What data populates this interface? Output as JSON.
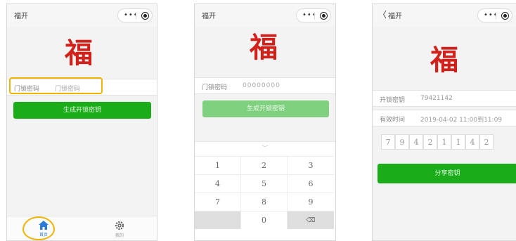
{
  "screen1": {
    "title": "福开",
    "fu": "福",
    "field_label": "门锁密码",
    "field_placeholder": "门锁密码",
    "button": "生成开锁密钥",
    "tabs": [
      {
        "label": "首页",
        "icon": "home-icon",
        "active": true
      },
      {
        "label": "我的",
        "icon": "settings-icon",
        "active": false
      }
    ]
  },
  "screen2": {
    "title": "福开",
    "fu": "福",
    "field_label": "门锁密码",
    "field_value": "00000000",
    "button": "生成开锁密钥",
    "keypad": [
      "1",
      "2",
      "3",
      "4",
      "5",
      "6",
      "7",
      "8",
      "9",
      "",
      "0",
      "⌫"
    ]
  },
  "screen3": {
    "title": "福开",
    "fu": "福",
    "key_label": "开锁密钥",
    "key_value": "79421142",
    "time_label": "有效时间",
    "time_value": "2019-04-02 11:00到11:09",
    "digits": [
      "7",
      "9",
      "4",
      "2",
      "1",
      "1",
      "4",
      "2"
    ],
    "button": "分享密钥"
  },
  "colors": {
    "accent_green": "#1aad19",
    "fu_red": "#d2201a",
    "highlight": "#f0b400",
    "tab_active": "#2a7bd8"
  }
}
